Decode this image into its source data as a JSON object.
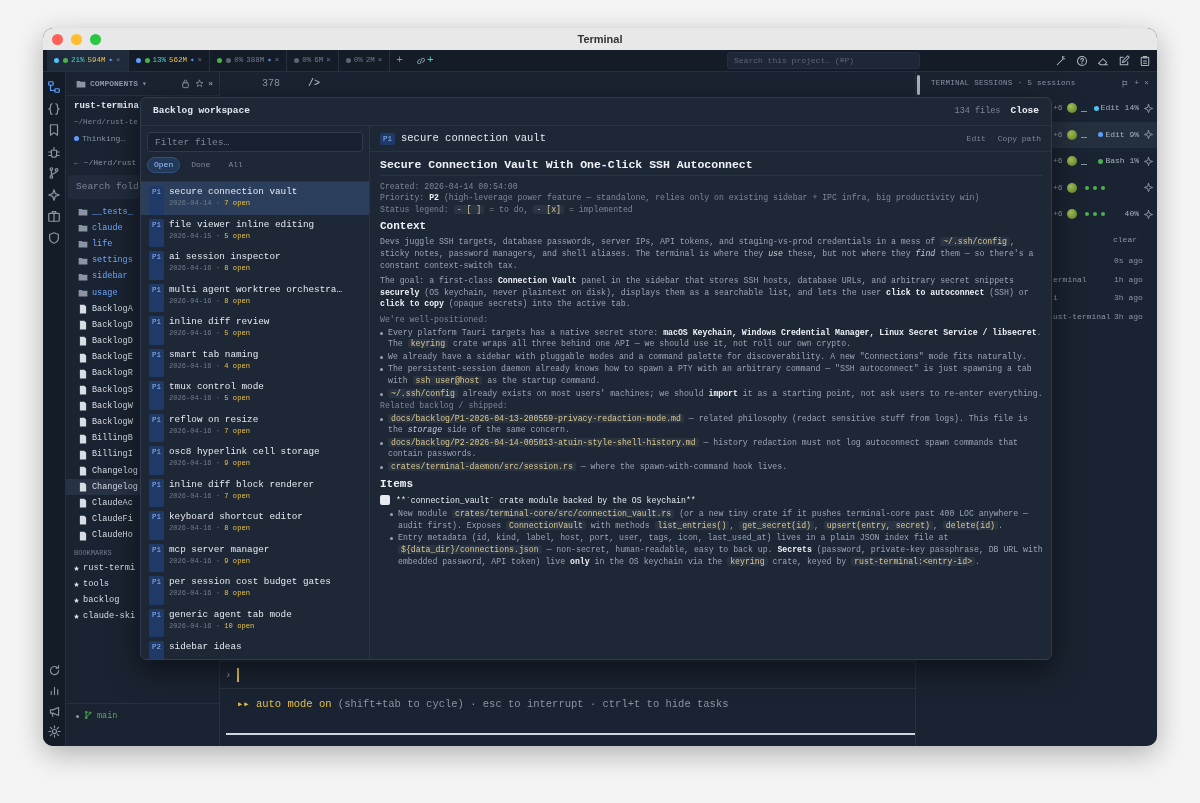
{
  "window": {
    "title": "Terminal"
  },
  "tabs": [
    {
      "dots": [
        {
          "color": "#4fc3f7"
        },
        {
          "color": "#4caf50"
        }
      ],
      "cpu": "21%",
      "mem": "594M",
      "marker": "✦",
      "busy": true,
      "selected": true,
      "close": "×"
    },
    {
      "dots": [
        {
          "color": "#5c9eff"
        },
        {
          "color": "#4caf50"
        }
      ],
      "cpu": "13%",
      "mem": "562M",
      "marker": "✦",
      "busy": true,
      "selected": false,
      "close": "×"
    },
    {
      "dots": [
        {
          "color": "#4caf50"
        },
        {
          "color": "#5b6472"
        }
      ],
      "cpu": "0%",
      "mem": "388M",
      "marker": "✦",
      "busy": false,
      "selected": false,
      "close": "×"
    },
    {
      "dots": [
        {
          "color": "#5b6472"
        }
      ],
      "cpu": "0%",
      "mem": "6M",
      "busy": false,
      "selected": false,
      "close": "×"
    },
    {
      "dots": [
        {
          "color": "#5b6472"
        }
      ],
      "cpu": "0%",
      "mem": "2M",
      "busy": false,
      "selected": false,
      "close": "×"
    }
  ],
  "new_tab": "+",
  "link_add": "+",
  "search": {
    "placeholder": "Search this project… (⌘P)"
  },
  "sidebar": {
    "header": "COMPONENTS",
    "caret": "▾",
    "close": "×",
    "project": "rust-termina",
    "path": "~/Herd/rust-te",
    "status": "Thinking…",
    "back": "← ~/Herd/rust",
    "search_placeholder": "Search fold",
    "tree": [
      {
        "name": "__tests_",
        "kind": "folder",
        "selected": false
      },
      {
        "name": "claude",
        "kind": "folder",
        "selected": false
      },
      {
        "name": "life",
        "kind": "folder",
        "selected": false
      },
      {
        "name": "settings",
        "kind": "folder",
        "selected": false
      },
      {
        "name": "sidebar",
        "kind": "folder",
        "selected": false
      },
      {
        "name": "usage",
        "kind": "folder",
        "selected": false
      },
      {
        "name": "BacklogA",
        "kind": "file",
        "selected": false
      },
      {
        "name": "BacklogD",
        "kind": "file",
        "selected": false
      },
      {
        "name": "BacklogD",
        "kind": "file",
        "selected": false
      },
      {
        "name": "BacklogE",
        "kind": "file",
        "selected": false
      },
      {
        "name": "BacklogR",
        "kind": "file",
        "selected": false
      },
      {
        "name": "BacklogS",
        "kind": "file",
        "selected": false
      },
      {
        "name": "BacklogW",
        "kind": "file",
        "selected": false
      },
      {
        "name": "BacklogW",
        "kind": "file",
        "selected": false
      },
      {
        "name": "BillingB",
        "kind": "file",
        "selected": false
      },
      {
        "name": "BillingI",
        "kind": "file",
        "selected": false
      },
      {
        "name": "Changelog",
        "kind": "file",
        "selected": false
      },
      {
        "name": "Changelog",
        "kind": "file",
        "selected": true
      },
      {
        "name": "ClaudeAc",
        "kind": "file",
        "selected": false
      },
      {
        "name": "ClaudeFi",
        "kind": "file",
        "selected": false
      },
      {
        "name": "ClaudeHo",
        "kind": "file",
        "selected": false
      }
    ],
    "bookmarks_label": "BOOKMARKS",
    "bookmarks": [
      "rust-termi",
      "tools",
      "backlog",
      "claude-ski"
    ],
    "branch": "main"
  },
  "editor": {
    "lines": [
      {
        "number": "378",
        "code": "/>"
      }
    ]
  },
  "terminal": {
    "prompt": "›",
    "mode": "▸▸ auto mode on",
    "hint": " (shift+tab to cycle) · esc to interrupt · ctrl+t to hide tasks"
  },
  "sessions": {
    "title": "TERMINAL SESSIONS",
    "separator": "·",
    "count": "5 sessions",
    "add": "+",
    "close": "×",
    "rows": [
      {
        "extra": "+6",
        "kind": "idle",
        "status": "Edit 14%",
        "color": "#4fc3f7",
        "selected": false
      },
      {
        "extra": "+6",
        "kind": "idle",
        "status": "Edit 9%",
        "color": "#5c9eff",
        "selected": true
      },
      {
        "extra": "+6",
        "kind": "idle",
        "status": "Bash 1%",
        "color": "#4caf50",
        "selected": false
      },
      {
        "extra": "+6",
        "kind": "busy",
        "selected": false
      },
      {
        "extra": "+6",
        "kind": "busy",
        "status": "40%",
        "selected": false
      }
    ],
    "clear": "clear",
    "recent": [
      {
        "time": "0s ago"
      },
      {
        "name": "erminal",
        "time": "1h ago"
      },
      {
        "name": "i",
        "time": "3h ago"
      },
      {
        "name": "ust-terminal",
        "time": "3h ago"
      }
    ]
  },
  "backlog": {
    "title": "Backlog workspace",
    "file_count": "134 files",
    "close": "Close",
    "filter_placeholder": "Filter files…",
    "filters": [
      {
        "label": "Open",
        "selected": true
      },
      {
        "label": "Done",
        "selected": false
      },
      {
        "label": "All",
        "selected": false
      }
    ],
    "items": [
      {
        "priority": "P1",
        "title": "secure connection vault",
        "date": "2026-04-14",
        "sep": "·",
        "open": "7 open",
        "selected": true
      },
      {
        "priority": "P1",
        "title": "file viewer inline editing",
        "date": "2026-04-15",
        "sep": "·",
        "open": "5 open",
        "selected": false
      },
      {
        "priority": "P1",
        "title": "ai session inspector",
        "date": "2026-04-16",
        "sep": "·",
        "open": "8 open",
        "selected": false
      },
      {
        "priority": "P1",
        "title": "multi agent worktree orchestra…",
        "date": "2026-04-16",
        "sep": "·",
        "open": "8 open",
        "selected": false
      },
      {
        "priority": "P1",
        "title": "inline diff review",
        "date": "2026-04-16",
        "sep": "·",
        "open": "5 open",
        "selected": false
      },
      {
        "priority": "P1",
        "title": "smart tab naming",
        "date": "2026-04-16",
        "sep": "·",
        "open": "4 open",
        "selected": false
      },
      {
        "priority": "P1",
        "title": "tmux control mode",
        "date": "2026-04-16",
        "sep": "·",
        "open": "5 open",
        "selected": false
      },
      {
        "priority": "P1",
        "title": "reflow on resize",
        "date": "2026-04-16",
        "sep": "·",
        "open": "7 open",
        "selected": false
      },
      {
        "priority": "P1",
        "title": "osc8 hyperlink cell storage",
        "date": "2026-04-16",
        "sep": "·",
        "open": "9 open",
        "selected": false
      },
      {
        "priority": "P1",
        "title": "inline diff block renderer",
        "date": "2026-04-16",
        "sep": "·",
        "open": "7 open",
        "selected": false
      },
      {
        "priority": "P1",
        "title": "keyboard shortcut editor",
        "date": "2026-04-16",
        "sep": "·",
        "open": "8 open",
        "selected": false
      },
      {
        "priority": "P1",
        "title": "mcp server manager",
        "date": "2026-04-16",
        "sep": "·",
        "open": "9 open",
        "selected": false
      },
      {
        "priority": "P1",
        "title": "per session cost budget gates",
        "date": "2026-04-16",
        "sep": "·",
        "open": "8 open",
        "selected": false
      },
      {
        "priority": "P1",
        "title": "generic agent tab mode",
        "date": "2026-04-16",
        "sep": "·",
        "open": "10 open",
        "selected": false
      },
      {
        "priority": "P2",
        "title": "sidebar ideas",
        "selected": false
      }
    ],
    "doc": {
      "priority": "P1",
      "name": "secure connection vault",
      "actions": [
        "Edit",
        "Copy path"
      ],
      "heading": "Secure Connection Vault With One-Click SSH Autoconnect",
      "blocks": [
        {
          "kind": "meta",
          "parts": [
            {
              "t": "Created: 2026-04-14 00:54:00"
            }
          ]
        },
        {
          "kind": "meta",
          "parts": [
            {
              "t": "Priority: **P2** (high-leverage power feature — standalone, relies only on existing sidebar + IPC infra, big productivity win)"
            }
          ]
        },
        {
          "kind": "meta",
          "parts": [
            {
              "t": "Status legend: "
            },
            {
              "c": "- [ ]"
            },
            {
              "t": " = to do, "
            },
            {
              "c": "- [x]"
            },
            {
              "t": " = implemented"
            }
          ]
        },
        {
          "kind": "h",
          "text": "Context"
        },
        {
          "kind": "p",
          "parts": [
            {
              "t": "Devs juggle SSH targets, database passwords, server IPs, API tokens, and staging-vs-prod credentials in a mess of "
            },
            {
              "c": "~/.ssh/config"
            },
            {
              "t": ", sticky notes, password managers, and shell aliases. The terminal is where they *use* these, but not where they *find* them — so there's a constant context-switch tax."
            }
          ]
        },
        {
          "kind": "p",
          "parts": [
            {
              "t": "The goal: a first-class **Connection Vault** panel in the sidebar that stores SSH hosts, database URLs, and arbitrary secret snippets **securely** (OS keychain, never plaintext on disk), displays them as a searchable list, and lets the user **click to autoconnect** (SSH) or **click to copy** (opaque secrets) into the active tab."
            }
          ]
        },
        {
          "kind": "label",
          "text": "We're well-positioned:"
        },
        {
          "kind": "bullet",
          "parts": [
            {
              "t": "Every platform Tauri targets has a native secret store: **macOS Keychain, Windows Credential Manager, Linux Secret Service / libsecret**. The "
            },
            {
              "c": "keyring"
            },
            {
              "t": " crate wraps all three behind one API — we should use it, not roll our own crypto."
            }
          ]
        },
        {
          "kind": "bullet",
          "parts": [
            {
              "t": "We already have a sidebar with pluggable modes and a command palette for discoverability. A new \"Connections\" mode fits naturally."
            }
          ]
        },
        {
          "kind": "bullet",
          "parts": [
            {
              "t": "The persistent-session daemon already knows how to spawn a PTY with an arbitrary command — \"SSH autoconnect\" is just spawning a tab with "
            },
            {
              "c": "ssh user@host"
            },
            {
              "t": " as the startup command."
            }
          ]
        },
        {
          "kind": "bullet",
          "parts": [
            {
              "c": "~/.ssh/config"
            },
            {
              "t": " already exists on most users' machines; we should **import** it as a starting point, not ask users to re-enter everything."
            }
          ]
        },
        {
          "kind": "label",
          "text": "Related backlog / shipped:"
        },
        {
          "kind": "bullet",
          "parts": [
            {
              "c": "docs/backlog/P1-2026-04-13-200559-privacy-redaction-mode.md"
            },
            {
              "t": " — related philosophy (redact sensitive stuff from logs). This file is the *storage* side of the same concern."
            }
          ]
        },
        {
          "kind": "bullet",
          "parts": [
            {
              "c": "docs/backlog/P2-2026-04-14-005013-atuin-style-shell-history.md"
            },
            {
              "t": " — history redaction must not log autoconnect spawn commands that contain passwords."
            }
          ]
        },
        {
          "kind": "bullet",
          "parts": [
            {
              "c": "crates/terminal-daemon/src/session.rs"
            },
            {
              "t": " — where the spawn-with-command hook lives."
            }
          ]
        },
        {
          "kind": "h",
          "text": "Items"
        },
        {
          "kind": "task",
          "checked": false,
          "text": "**`connection_vault` crate module backed by the OS keychain**"
        },
        {
          "kind": "subbullet",
          "parts": [
            {
              "t": "New module "
            },
            {
              "c": "crates/terminal-core/src/connection_vault.rs"
            },
            {
              "t": " (or a new tiny crate if it pushes terminal-core past 400 LOC anywhere — audit first). Exposes "
            },
            {
              "c": "ConnectionVault"
            },
            {
              "t": " with methods "
            },
            {
              "c": "list_entries()"
            },
            {
              "t": ", "
            },
            {
              "c": "get_secret(id)"
            },
            {
              "t": ", "
            },
            {
              "c": "upsert(entry, secret)"
            },
            {
              "t": ", "
            },
            {
              "c": "delete(id)"
            },
            {
              "t": "."
            }
          ]
        },
        {
          "kind": "subbullet",
          "parts": [
            {
              "t": "Entry metadata (id, kind, label, host, port, user, tags, icon, last_used_at) lives in a plain JSON index file at "
            },
            {
              "c": "${data_dir}/connections.json"
            },
            {
              "t": " — non-secret, human-readable, easy to back up. **Secrets** (password, private-key passphrase, DB URL with embedded password, API token) live **only** in the OS keychain via the "
            },
            {
              "c": "keyring"
            },
            {
              "t": " crate, keyed by "
            },
            {
              "c": "rust-terminal:<entry-id>"
            },
            {
              "t": "."
            }
          ]
        }
      ]
    }
  }
}
